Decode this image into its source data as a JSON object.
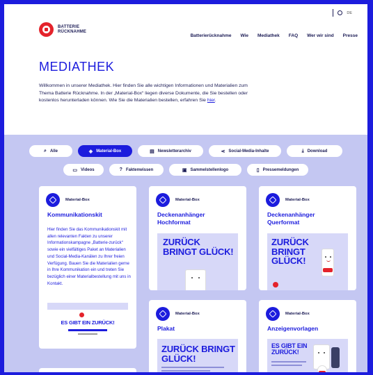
{
  "brand": {
    "line1": "BATTERIE",
    "line2": "RÜCKNAHME"
  },
  "lang": {
    "label": "DE"
  },
  "nav": [
    "Batterierücknahme",
    "Wie",
    "Mediathek",
    "FAQ",
    "Wer wir sind",
    "Presse"
  ],
  "page": {
    "title": "MEDIATHEK",
    "intro_prefix": "Willkommen in unserer Mediathek. Hier finden Sie alle wichtigen Informationen und Materialien zum Thema Batterie Rücknahme. In der „Material-Box“ liegen diverse Dokumente, die Sie bestellen oder kostenlos herunterladen können. Wie Sie die Materialien bestellen, erfahren Sie ",
    "intro_link": "hier",
    "intro_suffix": "."
  },
  "filters": {
    "row1": [
      {
        "icon": "⌕",
        "label": "Alle",
        "active": false
      },
      {
        "icon": "◈",
        "label": "Material-Box",
        "active": true
      },
      {
        "icon": "▤",
        "label": "Newsletterarchiv",
        "active": false
      },
      {
        "icon": "⋖",
        "label": "Social-Media-Inhalte",
        "active": false
      },
      {
        "icon": "⤓",
        "label": "Download",
        "active": false
      }
    ],
    "row2": [
      {
        "icon": "▭",
        "label": "Videos",
        "active": false
      },
      {
        "icon": "?",
        "label": "Faktenwissen",
        "active": false
      },
      {
        "icon": "▣",
        "label": "Sammelstellenlogo",
        "active": false
      },
      {
        "icon": "▯",
        "label": "Pressemeldungen",
        "active": false
      }
    ]
  },
  "cards": {
    "c1": {
      "category": "Material-Box",
      "title": "Kommunikationskit",
      "desc": "Hier finden Sie das Kommunikationskit mit allen relevanten Fakten zu unserer Informationskampagne „Batterie-zurück“ sowie ein vielfältiges Paket an Materialien und Social-Media-Kanälen zu Ihrer freien Verfügung. Bauen Sie die Materialien gerne in Ihre Kommunikation ein und treten Sie bezüglich einer Materialbestellung mit uns in Kontakt.",
      "preview_headline": "ES GIBT EIN ZURÜCK!"
    },
    "c2": {
      "category": "Material-Box",
      "title": "Deckenanhänger Hochformat",
      "preview_headline": "ZURÜCK BRINGT GLÜCK!"
    },
    "c3": {
      "category": "Material-Box",
      "title": "Deckenanhänger Querformat",
      "preview_headline": "ZURÜCK BRINGT GLÜCK!"
    },
    "c4": {
      "category": "Material-Box",
      "title": "Plakat",
      "preview_headline": "ZURÜCK BRINGT GLÜCK!"
    },
    "c5": {
      "category": "Material-Box",
      "title": "Anzeigenvorlagen",
      "preview_headline": "ES GIBT EIN ZURÜCK!"
    }
  },
  "colors": {
    "accent": "#1c1cdd",
    "brand_red": "#e4232b",
    "lavender": "#c4c7f2",
    "text": "#1b1b55"
  }
}
